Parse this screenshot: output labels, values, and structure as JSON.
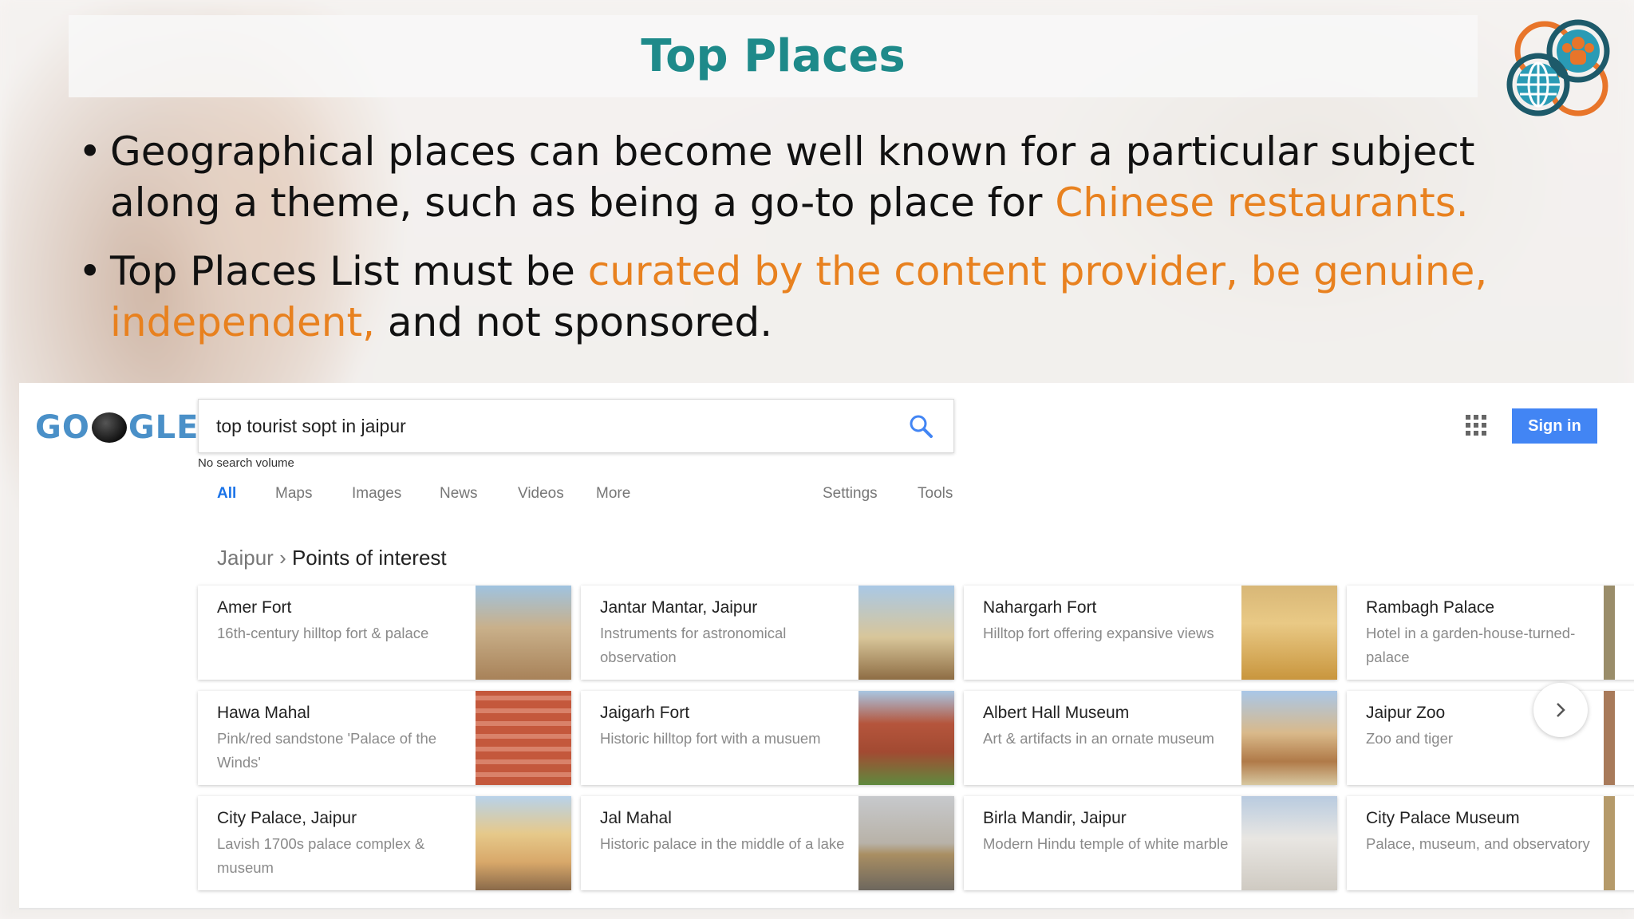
{
  "slide": {
    "title": "Top Places",
    "bullets": [
      {
        "parts": [
          {
            "text": "Geographical places can become well known for a particular subject along a theme, such as being a go-to place for ",
            "highlight": false
          },
          {
            "text": "Chinese restaurants.",
            "highlight": true
          }
        ]
      },
      {
        "parts": [
          {
            "text": "Top Places List must be ",
            "highlight": false
          },
          {
            "text": "curated by the content provider, be genuine, independent,",
            "highlight": true
          },
          {
            "text": " and not sponsored.",
            "highlight": false
          }
        ]
      }
    ]
  },
  "search": {
    "logo_left": "GO",
    "logo_right": "GLE",
    "query": "top tourist sopt in jaipur",
    "no_search_volume": "No search volume",
    "tabs": [
      "All",
      "Maps",
      "Images",
      "News",
      "Videos",
      "More"
    ],
    "tools": [
      "Settings",
      "Tools"
    ],
    "sign_in": "Sign in"
  },
  "breadcrumb": {
    "parent": "Jaipur",
    "separator": "›",
    "current": "Points of interest"
  },
  "places": [
    [
      {
        "name": "Amer Fort",
        "desc": "16th-century hilltop fort & palace"
      },
      {
        "name": "Jantar Mantar, Jaipur",
        "desc": "Instruments for astronomical observation"
      },
      {
        "name": "Nahargarh Fort",
        "desc": "Hilltop fort offering expansive views"
      },
      {
        "name": "Rambagh Palace",
        "desc": "Hotel in a garden-house-turned-palace"
      }
    ],
    [
      {
        "name": "Hawa Mahal",
        "desc": "Pink/red sandstone 'Palace of the Winds'"
      },
      {
        "name": "Jaigarh Fort",
        "desc": "Historic hilltop fort with a musuem"
      },
      {
        "name": "Albert Hall Museum",
        "desc": "Art & artifacts in an ornate museum"
      },
      {
        "name": "Jaipur Zoo",
        "desc": "Zoo and tiger"
      }
    ],
    [
      {
        "name": "City Palace, Jaipur",
        "desc": "Lavish 1700s palace complex & museum"
      },
      {
        "name": "Jal Mahal",
        "desc": "Historic palace in the middle of a lake"
      },
      {
        "name": "Birla Mandir, Jaipur",
        "desc": "Modern Hindu temple of white marble"
      },
      {
        "name": "City Palace Museum",
        "desc": "Palace, museum, and observatory"
      }
    ]
  ],
  "colors": {
    "title": "#1e8a8a",
    "highlight": "#e8811f",
    "link_blue": "#1a73e8",
    "signin_bg": "#4285f4"
  }
}
